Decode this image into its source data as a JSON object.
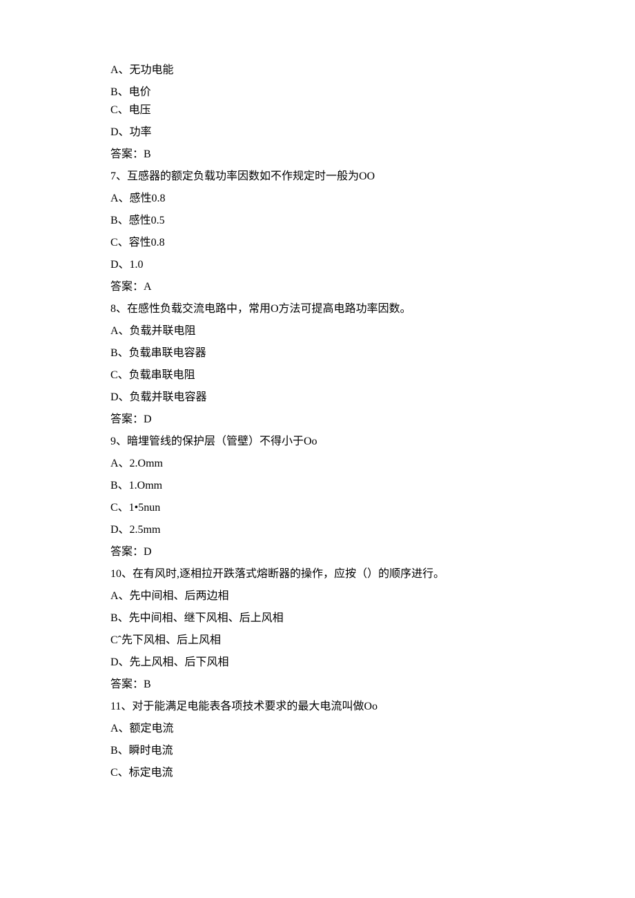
{
  "lines": {
    "l0": "A、无功电能",
    "l1": "B、电价",
    "l2": "C、电压",
    "l3": "D、功率",
    "l4": "答案：B",
    "l5": "7、互感器的额定负载功率因数如不作规定时一般为OO",
    "l6": "A、感性0.8",
    "l7": "B、感性0.5",
    "l8": "C、容性0.8",
    "l9": "D、1.0",
    "l10": "答案：A",
    "l11": "8、在感性负载交流电路中，常用O方法可提高电路功率因数。",
    "l12": "A、负载并联电阻",
    "l13": "B、负载串联电容器",
    "l14": "C、负载串联电阻",
    "l15": "D、负载并联电容器",
    "l16": "答案：D",
    "l17": "9、暗埋管线的保护层（管壁）不得小于Oo",
    "l18": "A、2.Omm",
    "l19": "B、1.Omm",
    "l20": "C、1•5nun",
    "l21": "D、2.5mm",
    "l22": "答案：D",
    "l23": "10、在有风时,逐相拉开跌落式熔断器的操作，应按（）的顺序进行。",
    "l24": "A、先中间相、后两边相",
    "l25": "B、先中间相、继下风相、后上风相",
    "l26": "Cˆ先下风相、后上风相",
    "l27": "D、先上风相、后下风相",
    "l28": "答案：B",
    "l29": "11、对于能满足电能表各项技术要求的最大电流叫做Oo",
    "l30": "A、额定电流",
    "l31": "B、瞬时电流",
    "l32": "C、标定电流"
  }
}
